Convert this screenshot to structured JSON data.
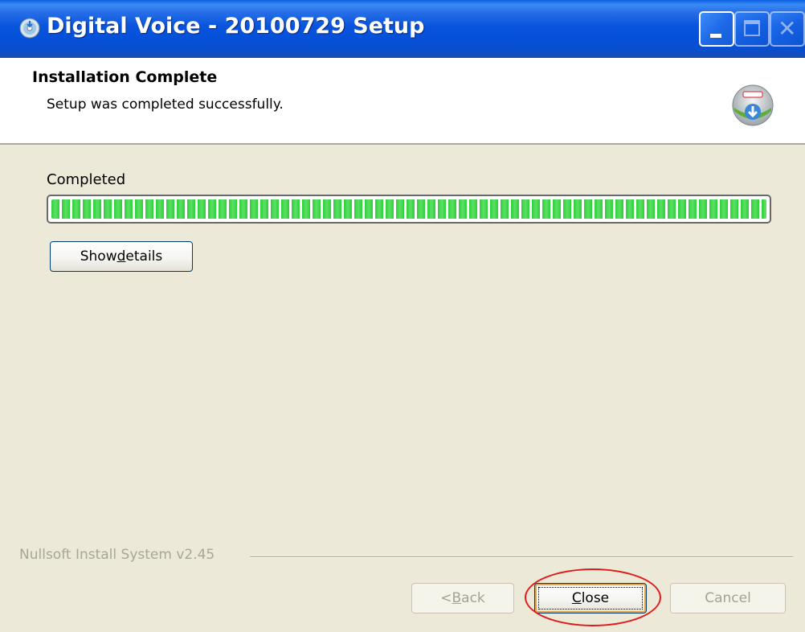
{
  "window": {
    "title": "Digital Voice - 20100729 Setup"
  },
  "header": {
    "title": "Installation Complete",
    "subtitle": "Setup was completed successfully."
  },
  "body": {
    "status_label": "Completed",
    "progress_percent": 100,
    "show_details": {
      "pre": "Show ",
      "accel": "d",
      "post": "etails"
    }
  },
  "footer": {
    "brand": "Nullsoft Install System v2.45",
    "back": {
      "pre": "< ",
      "accel": "B",
      "post": "ack"
    },
    "close": {
      "pre": "",
      "accel": "C",
      "post": "lose"
    },
    "cancel": "Cancel"
  },
  "colors": {
    "title_bar": "#0854dd",
    "progress": "#2fcf3a",
    "annotation": "#e01a1a"
  },
  "icons": {
    "app": "setup-disc-icon",
    "header": "nsis-installer-icon"
  }
}
